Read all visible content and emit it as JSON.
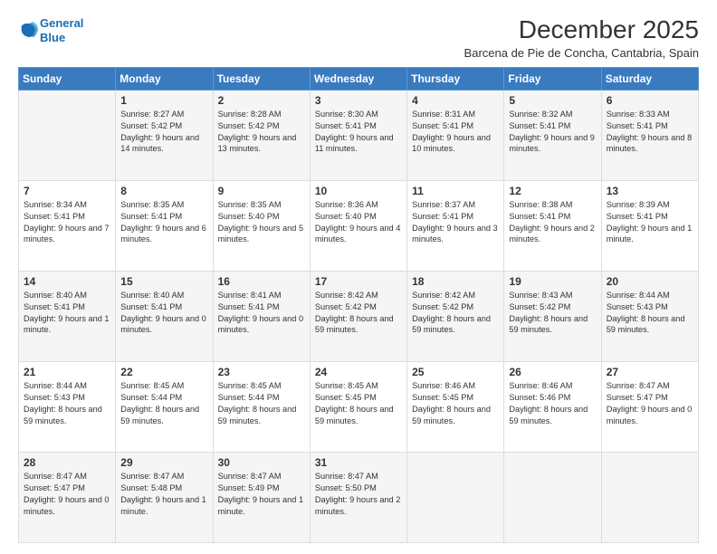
{
  "logo": {
    "line1": "General",
    "line2": "Blue"
  },
  "header": {
    "title": "December 2025",
    "subtitle": "Barcena de Pie de Concha, Cantabria, Spain"
  },
  "weekdays": [
    "Sunday",
    "Monday",
    "Tuesday",
    "Wednesday",
    "Thursday",
    "Friday",
    "Saturday"
  ],
  "weeks": [
    [
      {
        "day": "",
        "sunrise": "",
        "sunset": "",
        "daylight": ""
      },
      {
        "day": "1",
        "sunrise": "Sunrise: 8:27 AM",
        "sunset": "Sunset: 5:42 PM",
        "daylight": "Daylight: 9 hours and 14 minutes."
      },
      {
        "day": "2",
        "sunrise": "Sunrise: 8:28 AM",
        "sunset": "Sunset: 5:42 PM",
        "daylight": "Daylight: 9 hours and 13 minutes."
      },
      {
        "day": "3",
        "sunrise": "Sunrise: 8:30 AM",
        "sunset": "Sunset: 5:41 PM",
        "daylight": "Daylight: 9 hours and 11 minutes."
      },
      {
        "day": "4",
        "sunrise": "Sunrise: 8:31 AM",
        "sunset": "Sunset: 5:41 PM",
        "daylight": "Daylight: 9 hours and 10 minutes."
      },
      {
        "day": "5",
        "sunrise": "Sunrise: 8:32 AM",
        "sunset": "Sunset: 5:41 PM",
        "daylight": "Daylight: 9 hours and 9 minutes."
      },
      {
        "day": "6",
        "sunrise": "Sunrise: 8:33 AM",
        "sunset": "Sunset: 5:41 PM",
        "daylight": "Daylight: 9 hours and 8 minutes."
      }
    ],
    [
      {
        "day": "7",
        "sunrise": "Sunrise: 8:34 AM",
        "sunset": "Sunset: 5:41 PM",
        "daylight": "Daylight: 9 hours and 7 minutes."
      },
      {
        "day": "8",
        "sunrise": "Sunrise: 8:35 AM",
        "sunset": "Sunset: 5:41 PM",
        "daylight": "Daylight: 9 hours and 6 minutes."
      },
      {
        "day": "9",
        "sunrise": "Sunrise: 8:35 AM",
        "sunset": "Sunset: 5:40 PM",
        "daylight": "Daylight: 9 hours and 5 minutes."
      },
      {
        "day": "10",
        "sunrise": "Sunrise: 8:36 AM",
        "sunset": "Sunset: 5:40 PM",
        "daylight": "Daylight: 9 hours and 4 minutes."
      },
      {
        "day": "11",
        "sunrise": "Sunrise: 8:37 AM",
        "sunset": "Sunset: 5:41 PM",
        "daylight": "Daylight: 9 hours and 3 minutes."
      },
      {
        "day": "12",
        "sunrise": "Sunrise: 8:38 AM",
        "sunset": "Sunset: 5:41 PM",
        "daylight": "Daylight: 9 hours and 2 minutes."
      },
      {
        "day": "13",
        "sunrise": "Sunrise: 8:39 AM",
        "sunset": "Sunset: 5:41 PM",
        "daylight": "Daylight: 9 hours and 1 minute."
      }
    ],
    [
      {
        "day": "14",
        "sunrise": "Sunrise: 8:40 AM",
        "sunset": "Sunset: 5:41 PM",
        "daylight": "Daylight: 9 hours and 1 minute."
      },
      {
        "day": "15",
        "sunrise": "Sunrise: 8:40 AM",
        "sunset": "Sunset: 5:41 PM",
        "daylight": "Daylight: 9 hours and 0 minutes."
      },
      {
        "day": "16",
        "sunrise": "Sunrise: 8:41 AM",
        "sunset": "Sunset: 5:41 PM",
        "daylight": "Daylight: 9 hours and 0 minutes."
      },
      {
        "day": "17",
        "sunrise": "Sunrise: 8:42 AM",
        "sunset": "Sunset: 5:42 PM",
        "daylight": "Daylight: 8 hours and 59 minutes."
      },
      {
        "day": "18",
        "sunrise": "Sunrise: 8:42 AM",
        "sunset": "Sunset: 5:42 PM",
        "daylight": "Daylight: 8 hours and 59 minutes."
      },
      {
        "day": "19",
        "sunrise": "Sunrise: 8:43 AM",
        "sunset": "Sunset: 5:42 PM",
        "daylight": "Daylight: 8 hours and 59 minutes."
      },
      {
        "day": "20",
        "sunrise": "Sunrise: 8:44 AM",
        "sunset": "Sunset: 5:43 PM",
        "daylight": "Daylight: 8 hours and 59 minutes."
      }
    ],
    [
      {
        "day": "21",
        "sunrise": "Sunrise: 8:44 AM",
        "sunset": "Sunset: 5:43 PM",
        "daylight": "Daylight: 8 hours and 59 minutes."
      },
      {
        "day": "22",
        "sunrise": "Sunrise: 8:45 AM",
        "sunset": "Sunset: 5:44 PM",
        "daylight": "Daylight: 8 hours and 59 minutes."
      },
      {
        "day": "23",
        "sunrise": "Sunrise: 8:45 AM",
        "sunset": "Sunset: 5:44 PM",
        "daylight": "Daylight: 8 hours and 59 minutes."
      },
      {
        "day": "24",
        "sunrise": "Sunrise: 8:45 AM",
        "sunset": "Sunset: 5:45 PM",
        "daylight": "Daylight: 8 hours and 59 minutes."
      },
      {
        "day": "25",
        "sunrise": "Sunrise: 8:46 AM",
        "sunset": "Sunset: 5:45 PM",
        "daylight": "Daylight: 8 hours and 59 minutes."
      },
      {
        "day": "26",
        "sunrise": "Sunrise: 8:46 AM",
        "sunset": "Sunset: 5:46 PM",
        "daylight": "Daylight: 8 hours and 59 minutes."
      },
      {
        "day": "27",
        "sunrise": "Sunrise: 8:47 AM",
        "sunset": "Sunset: 5:47 PM",
        "daylight": "Daylight: 9 hours and 0 minutes."
      }
    ],
    [
      {
        "day": "28",
        "sunrise": "Sunrise: 8:47 AM",
        "sunset": "Sunset: 5:47 PM",
        "daylight": "Daylight: 9 hours and 0 minutes."
      },
      {
        "day": "29",
        "sunrise": "Sunrise: 8:47 AM",
        "sunset": "Sunset: 5:48 PM",
        "daylight": "Daylight: 9 hours and 1 minute."
      },
      {
        "day": "30",
        "sunrise": "Sunrise: 8:47 AM",
        "sunset": "Sunset: 5:49 PM",
        "daylight": "Daylight: 9 hours and 1 minute."
      },
      {
        "day": "31",
        "sunrise": "Sunrise: 8:47 AM",
        "sunset": "Sunset: 5:50 PM",
        "daylight": "Daylight: 9 hours and 2 minutes."
      },
      {
        "day": "",
        "sunrise": "",
        "sunset": "",
        "daylight": ""
      },
      {
        "day": "",
        "sunrise": "",
        "sunset": "",
        "daylight": ""
      },
      {
        "day": "",
        "sunrise": "",
        "sunset": "",
        "daylight": ""
      }
    ]
  ]
}
